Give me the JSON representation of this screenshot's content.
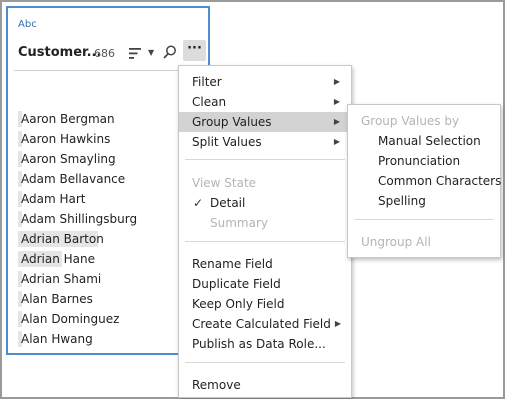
{
  "card": {
    "type_label": "Abc",
    "field_name": "Customer...",
    "field_count": "686",
    "more_label": "···",
    "values": [
      {
        "label": "Aaron Bergman",
        "bar_fraction": 0.0
      },
      {
        "label": "Aaron Hawkins",
        "bar_fraction": 0.0
      },
      {
        "label": "Aaron Smayling",
        "bar_fraction": 0.0
      },
      {
        "label": "Adam Bellavance",
        "bar_fraction": 0.0
      },
      {
        "label": "Adam Hart",
        "bar_fraction": 0.0
      },
      {
        "label": "Adam Shillingsburg",
        "bar_fraction": 0.0
      },
      {
        "label": "Adrian Barton",
        "bar_fraction": 1.0
      },
      {
        "label": "Adrian Hane",
        "bar_fraction": 0.53
      },
      {
        "label": "Adrian Shami",
        "bar_fraction": 0.0
      },
      {
        "label": "Alan Barnes",
        "bar_fraction": 0.0
      },
      {
        "label": "Alan Dominguez",
        "bar_fraction": 0.0
      },
      {
        "label": "Alan Hwang",
        "bar_fraction": 0.0
      }
    ]
  },
  "menu": {
    "filter": "Filter",
    "clean": "Clean",
    "group_values": "Group Values",
    "split_values": "Split Values",
    "view_state_header": "View State",
    "detail": "Detail",
    "summary": "Summary",
    "rename_field": "Rename Field",
    "duplicate_field": "Duplicate Field",
    "keep_only_field": "Keep Only Field",
    "create_calculated_field": "Create Calculated Field",
    "publish_as_data_role": "Publish as Data Role...",
    "remove": "Remove"
  },
  "submenu": {
    "header": "Group Values by",
    "manual_selection": "Manual Selection",
    "pronunciation": "Pronunciation",
    "common_characters": "Common Characters",
    "spelling": "Spelling",
    "ungroup_all": "Ungroup All"
  },
  "colors": {
    "card_border": "#4d8ecf",
    "menu_highlight": "#d3d3d3",
    "disabled_text": "#b4b4b4"
  }
}
